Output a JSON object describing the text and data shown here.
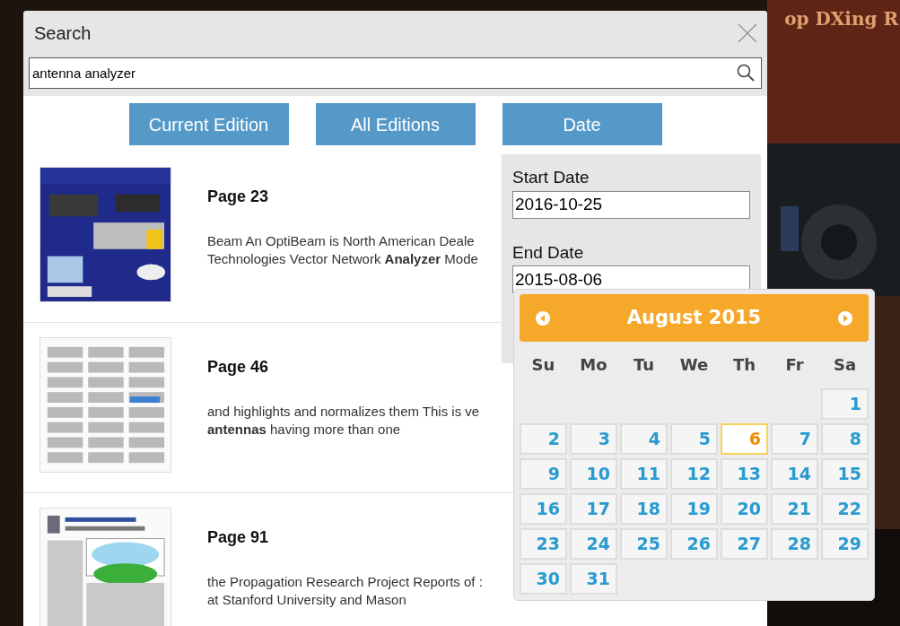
{
  "background": {
    "heading": "op DXing R",
    "kind": "picture"
  },
  "dialog": {
    "title": "Search",
    "search": {
      "value": "antenna analyzer"
    },
    "filters": [
      {
        "label": "Current Edition"
      },
      {
        "label": "All Editions"
      },
      {
        "label": "Date"
      }
    ],
    "results": [
      {
        "title": "Page 23",
        "thumbnail": {
          "kind": "picture"
        },
        "snippet_lines": [
          "Beam An OptiBeam is North American Deale",
          "Technologies Vector Network **Analyzer** Mode"
        ]
      },
      {
        "title": "Page 46",
        "thumbnail": {
          "kind": "picture"
        },
        "snippet_lines": [
          "and highlights and normalizes them This is ve",
          "**antennas** having more than one"
        ]
      },
      {
        "title": "Page 91",
        "thumbnail": {
          "kind": "picture"
        },
        "snippet_lines": [
          "the Propagation Research Project Reports of :",
          "at Stanford University and Mason"
        ]
      }
    ]
  },
  "date_panel": {
    "start_label": "Start Date",
    "start_value": "2016-10-25",
    "end_label": "End Date",
    "end_value": "2015-08-06"
  },
  "calendar": {
    "month": "August 2015",
    "weekdays": [
      "Su",
      "Mo",
      "Tu",
      "We",
      "Th",
      "Fr",
      "Sa"
    ],
    "weeks": [
      [
        {
          "label": "1",
          "selected": false
        }
      ],
      [
        {
          "label": "2",
          "selected": false
        },
        {
          "label": "3",
          "selected": false
        },
        {
          "label": "4",
          "selected": false
        },
        {
          "label": "5",
          "selected": false
        },
        {
          "label": "6",
          "selected": true
        },
        {
          "label": "7",
          "selected": false
        },
        {
          "label": "8",
          "selected": false
        }
      ],
      [
        {
          "label": "9",
          "selected": false
        },
        {
          "label": "10",
          "selected": false
        },
        {
          "label": "11",
          "selected": false
        },
        {
          "label": "12",
          "selected": false
        },
        {
          "label": "13",
          "selected": false
        },
        {
          "label": "14",
          "selected": false
        },
        {
          "label": "15",
          "selected": false
        }
      ],
      [
        {
          "label": "16",
          "selected": false
        },
        {
          "label": "17",
          "selected": false
        },
        {
          "label": "18",
          "selected": false
        },
        {
          "label": "19",
          "selected": false
        },
        {
          "label": "20",
          "selected": false
        },
        {
          "label": "21",
          "selected": false
        },
        {
          "label": "22",
          "selected": false
        }
      ],
      [
        {
          "label": "23",
          "selected": false
        },
        {
          "label": "24",
          "selected": false
        },
        {
          "label": "25",
          "selected": false
        },
        {
          "label": "26",
          "selected": false
        },
        {
          "label": "27",
          "selected": false
        },
        {
          "label": "28",
          "selected": false
        },
        {
          "label": "29",
          "selected": false
        }
      ],
      [
        {
          "label": "30",
          "selected": false
        },
        {
          "label": "31",
          "selected": false
        }
      ]
    ]
  }
}
